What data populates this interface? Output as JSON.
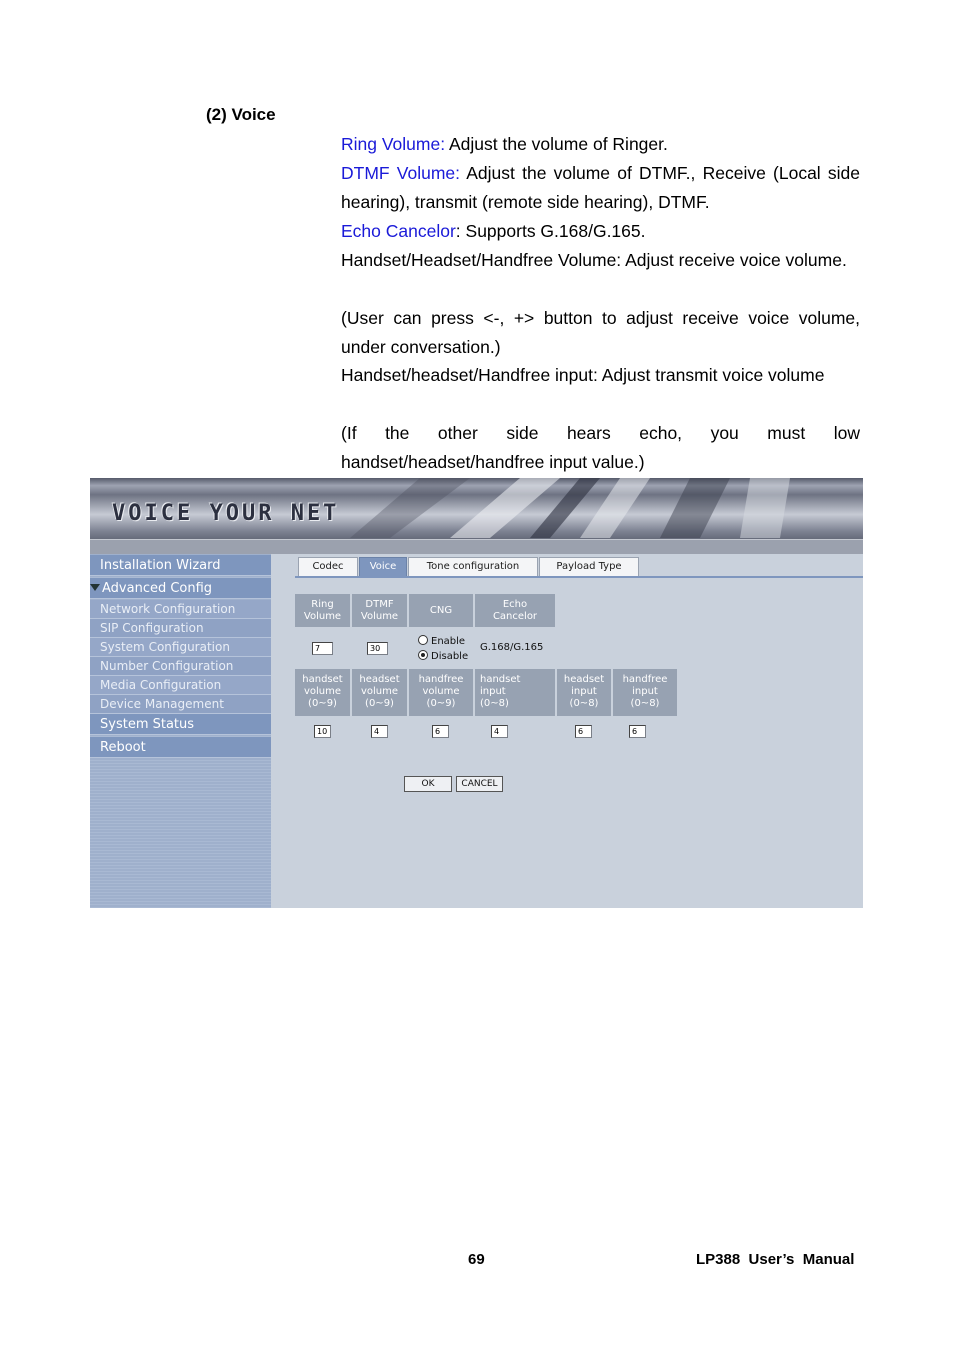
{
  "section": {
    "title": "(2) Voice"
  },
  "paragraphs": {
    "ring": {
      "term": "Ring Volume:",
      "text": " Adjust the volume of Ringer."
    },
    "dtmf": {
      "term": "DTMF Volume:",
      "text": " Adjust the volume of DTMF., Receive (Local side hearing), transmit (remote side hearing), DTMF."
    },
    "echo": {
      "term": "Echo Cancelor",
      "text": ": Supports G.168/G.165."
    },
    "volume": "Handset/Headset/Handfree Volume: Adjust receive voice volume.",
    "volume_note": "(User can press <-, +> button to adjust receive voice volume, under conversation.)",
    "input": "Handset/headset/Handfree input: Adjust transmit voice volume",
    "input_note": "(If the other side hears echo, you must low handset/headset/handfree input value.)"
  },
  "screenshot": {
    "logo": "VOICE YOUR NET",
    "menu": {
      "installation_wizard": "Installation Wizard",
      "advanced_config": "Advanced Config",
      "sub": [
        "Network Configuration",
        "SIP Configuration",
        "System Configuration",
        "Number Configuration",
        "Media Configuration",
        "Device Management"
      ],
      "system_status": "System Status",
      "reboot": "Reboot"
    },
    "tabs": [
      "Codec",
      "Voice",
      "Tone configuration",
      "Payload Type"
    ],
    "active_tab": "Voice",
    "top_headers": {
      "ring": [
        "Ring",
        "Volume"
      ],
      "dtmf": [
        "DTMF",
        "Volume"
      ],
      "cng": "CNG",
      "echo": [
        "Echo",
        "Cancelor"
      ]
    },
    "top_values": {
      "ring": "7",
      "dtmf": "30"
    },
    "cng_options": {
      "enable": "Enable",
      "disable": "Disable",
      "selected": "Disable"
    },
    "echo_value": "G.168/G.165",
    "bottom_headers": [
      [
        "handset",
        "volume",
        "(0~9)"
      ],
      [
        "headset",
        "volume",
        "(0~9)"
      ],
      [
        "handfree",
        "volume",
        "(0~9)"
      ],
      [
        "handset",
        "input",
        "(0~8)"
      ],
      [
        "headset",
        "input",
        "(0~8)"
      ],
      [
        "handfree",
        "input",
        "(0~8)"
      ]
    ],
    "bottom_values": [
      "10",
      "4",
      "6",
      "4",
      "6",
      "6"
    ],
    "buttons": {
      "ok": "OK",
      "cancel": "CANCEL"
    }
  },
  "footer": {
    "page": "69",
    "manual": "LP388  User’s  Manual"
  }
}
